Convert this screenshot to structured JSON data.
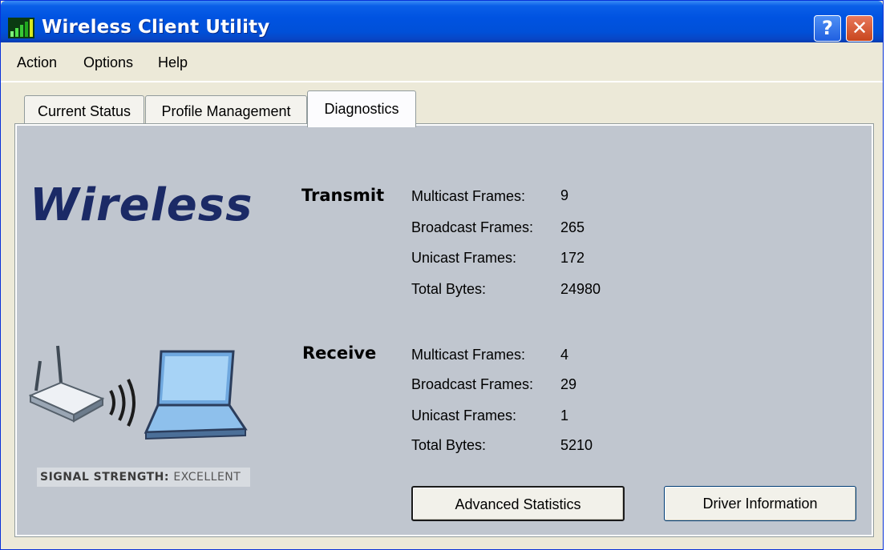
{
  "window": {
    "title": "Wireless Client Utility",
    "help_label": "?",
    "close_label": "✕"
  },
  "menu": [
    "Action",
    "Options",
    "Help"
  ],
  "tabs": [
    "Current Status",
    "Profile Management",
    "Diagnostics"
  ],
  "active_tab": "Diagnostics",
  "logo_text": "Wireless",
  "signal": {
    "label": "SIGNAL STRENGTH:",
    "value": "EXCELLENT"
  },
  "transmit": {
    "title": "Transmit",
    "rows": [
      {
        "label": "Multicast Frames:",
        "value": "9"
      },
      {
        "label": "Broadcast Frames:",
        "value": "265"
      },
      {
        "label": "Unicast Frames:",
        "value": "172"
      },
      {
        "label": "Total Bytes:",
        "value": "24980"
      }
    ]
  },
  "receive": {
    "title": "Receive",
    "rows": [
      {
        "label": "Multicast Frames:",
        "value": "4"
      },
      {
        "label": "Broadcast Frames:",
        "value": "29"
      },
      {
        "label": "Unicast Frames:",
        "value": "1"
      },
      {
        "label": "Total Bytes:",
        "value": "5210"
      }
    ]
  },
  "buttons": {
    "advanced": "Advanced Statistics",
    "driver": "Driver Information"
  },
  "colors": {
    "titlebar": "#0053e1",
    "panel": "#c0c6cf",
    "logo": "#1b2a66"
  },
  "icons": {
    "app": "wireless-signal-icon",
    "help": "help-icon",
    "close": "close-icon",
    "router": "router-icon",
    "laptop": "laptop-icon",
    "waves": "signal-waves-icon"
  }
}
